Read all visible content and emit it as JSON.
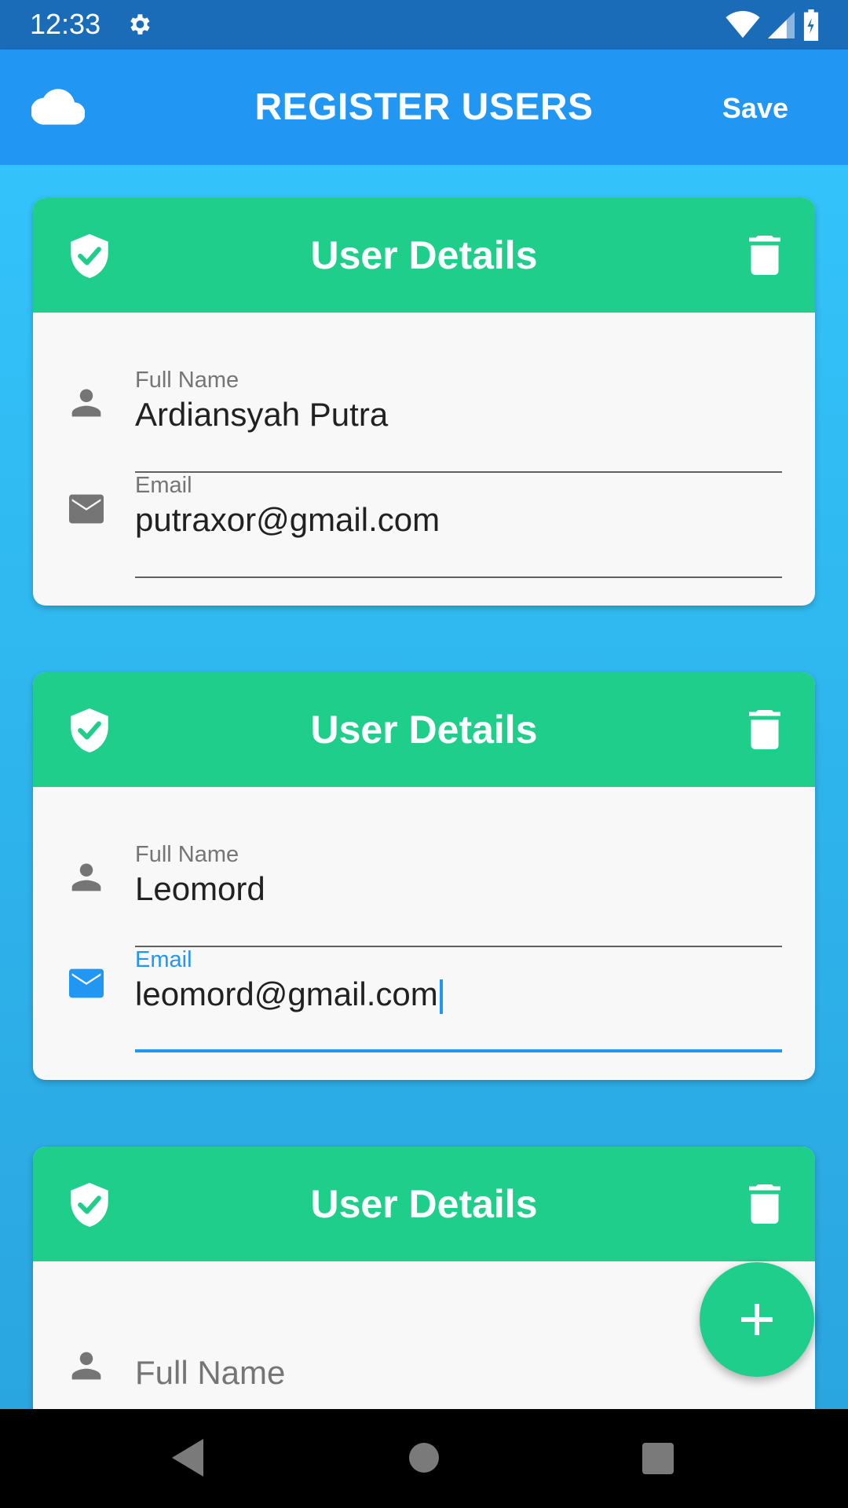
{
  "status_bar": {
    "time": "12:33"
  },
  "app_bar": {
    "title": "REGISTER USERS",
    "save_label": "Save"
  },
  "cards": [
    {
      "title": "User Details",
      "full_name": {
        "label": "Full Name",
        "value": "Ardiansyah Putra"
      },
      "email": {
        "label": "Email",
        "value": "putraxor@gmail.com"
      }
    },
    {
      "title": "User Details",
      "full_name": {
        "label": "Full Name",
        "value": "Leomord"
      },
      "email": {
        "label": "Email",
        "value": "leomord@gmail.com"
      }
    },
    {
      "title": "User Details",
      "full_name": {
        "placeholder": "Full Name"
      }
    }
  ],
  "colors": {
    "app_bar": "#2196F3",
    "status_bar": "#1A6BB8",
    "card_header": "#20CE8C",
    "accent": "#2196F3",
    "fab": "#20CE8C"
  },
  "icons": {
    "status": [
      "gear-icon",
      "wifi-icon",
      "signal-icon",
      "battery-icon"
    ],
    "app_bar": "cloud-icon",
    "card_header": [
      "shield-check-icon",
      "trash-icon"
    ],
    "fields": [
      "person-icon",
      "email-icon"
    ],
    "fab": "plus-icon",
    "nav": [
      "back-icon",
      "home-icon",
      "recents-icon"
    ]
  }
}
